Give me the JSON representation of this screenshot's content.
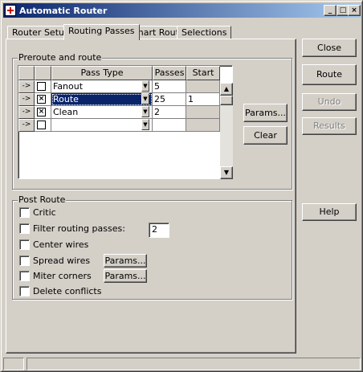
{
  "window": {
    "title": "Automatic Router"
  },
  "titlebar_buttons": {
    "minimize": "_",
    "maximize": "□",
    "close": "×"
  },
  "tabs": [
    {
      "label": "Router Setup",
      "active": false
    },
    {
      "label": "Routing Passes",
      "active": true
    },
    {
      "label": "Smart Router",
      "active": false
    },
    {
      "label": "Selections",
      "active": false
    }
  ],
  "preroute": {
    "group_label": "Preroute and route",
    "columns": [
      "Pass Type",
      "Passes",
      "Start"
    ],
    "rows": [
      {
        "marker": "->",
        "checked": false,
        "pass_type": "Fanout",
        "passes": "5",
        "start": "",
        "selected": false
      },
      {
        "marker": "->",
        "checked": true,
        "pass_type": "Route",
        "passes": "25",
        "start": "1",
        "selected": true
      },
      {
        "marker": "->",
        "checked": true,
        "pass_type": "Clean",
        "passes": "2",
        "start": "",
        "selected": false
      },
      {
        "marker": "->",
        "checked": false,
        "pass_type": "",
        "passes": "",
        "start": "",
        "selected": false
      }
    ],
    "params_button": "Params...",
    "clear_button": "Clear"
  },
  "post_route": {
    "group_label": "Post Route",
    "options": {
      "critic": "Critic",
      "filter": "Filter routing passes:",
      "center": "Center wires",
      "spread": "Spread wires",
      "miter": "Miter corners",
      "delete": "Delete conflicts"
    },
    "filter_value": "2",
    "spread_params": "Params...",
    "miter_params": "Params..."
  },
  "side_buttons": {
    "close": "Close",
    "route": "Route",
    "undo": "Undo",
    "results": "Results",
    "help": "Help"
  },
  "icons": {
    "row_marker": "arrow-right-icon",
    "dropdown": "chevron-down-icon",
    "scroll_up": "scroll-up-icon",
    "scroll_down": "scroll-down-icon"
  },
  "colors": {
    "title_start": "#0a246a",
    "title_end": "#a6caf0",
    "selection": "#0a246a",
    "face": "#d4d0c8"
  }
}
